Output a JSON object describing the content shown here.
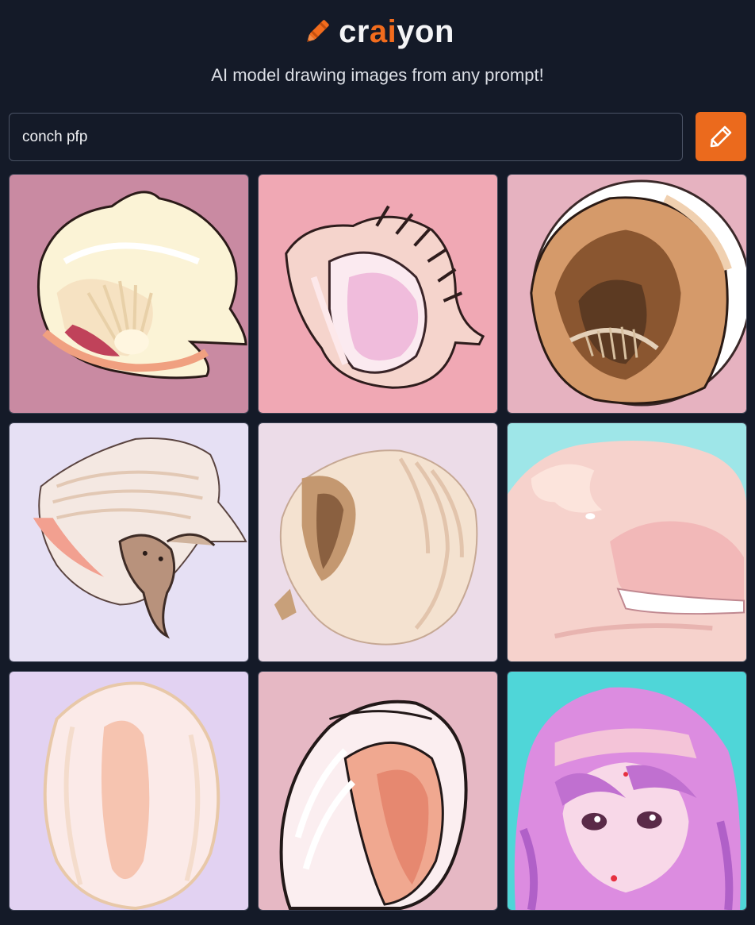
{
  "app": {
    "logo_prefix": "cr",
    "logo_accent": "ai",
    "logo_suffix": "yon",
    "logo_icon": "crayon-icon",
    "tagline": "AI model drawing images from any prompt!"
  },
  "prompt": {
    "value": "conch pfp",
    "submit_icon": "pencil-icon"
  },
  "colors": {
    "background": "#141a28",
    "accent": "#eb6a1d",
    "input_border": "#4b5365"
  },
  "results": [
    {
      "label": "generated-image-1",
      "bg": "#c98aa2"
    },
    {
      "label": "generated-image-2",
      "bg": "#f0a8b4"
    },
    {
      "label": "generated-image-3",
      "bg": "#e6b2c0"
    },
    {
      "label": "generated-image-4",
      "bg": "#e6e0f4"
    },
    {
      "label": "generated-image-5",
      "bg": "#ecdce8"
    },
    {
      "label": "generated-image-6",
      "bg": "#9ee6e8"
    },
    {
      "label": "generated-image-7",
      "bg": "#e2d2f2"
    },
    {
      "label": "generated-image-8",
      "bg": "#e6b8c4"
    },
    {
      "label": "generated-image-9",
      "bg": "#4fd6d8"
    }
  ]
}
